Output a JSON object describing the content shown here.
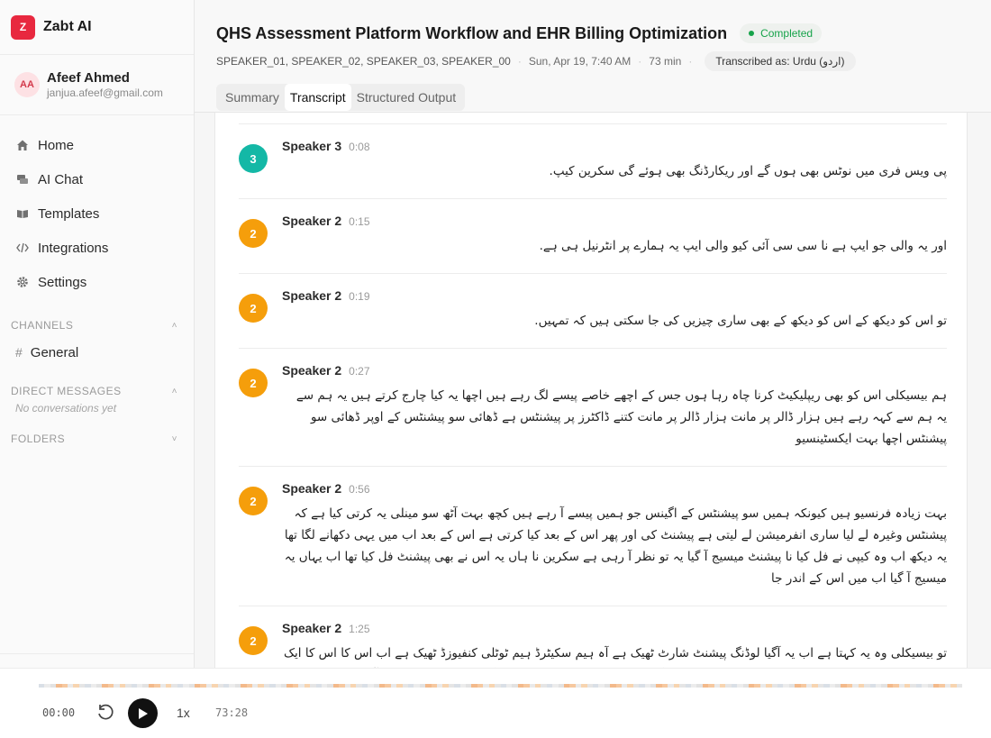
{
  "app": {
    "logo_letter": "Z",
    "name": "Zabt AI"
  },
  "user": {
    "initials": "AA",
    "name": "Afeef Ahmed",
    "email": "janjua.afeef@gmail.com"
  },
  "nav": [
    {
      "label": "Home",
      "icon": "home-icon"
    },
    {
      "label": "AI Chat",
      "icon": "chat-icon"
    },
    {
      "label": "Templates",
      "icon": "book-icon"
    },
    {
      "label": "Integrations",
      "icon": "code-icon"
    },
    {
      "label": "Settings",
      "icon": "gear-icon"
    }
  ],
  "channels": {
    "heading": "CHANNELS",
    "items": [
      {
        "label": "General"
      }
    ]
  },
  "direct_messages": {
    "heading": "DIRECT MESSAGES",
    "empty": "No conversations yet"
  },
  "folders": {
    "heading": "FOLDERS"
  },
  "recording": {
    "title": "QHS Assessment Platform Workflow and EHR Billing Optimization",
    "status": "Completed",
    "speakers": "SPEAKER_01, SPEAKER_02, SPEAKER_03, SPEAKER_00",
    "date": "Sun, Apr 19, 7:40 AM",
    "duration": "73 min",
    "language": "Transcribed as: Urdu (اردو)"
  },
  "tabs": [
    "Summary",
    "Transcript",
    "Structured Output"
  ],
  "colors": {
    "speaker_2": "#f59e0b",
    "speaker_3": "#14b8a6",
    "accent": "#e8283f",
    "status": "#16a34a"
  },
  "transcript": [
    {
      "num": "3",
      "speaker": "Speaker 3",
      "time": "0:08",
      "text": "پی ویس فری میں نوٹس بھی ہوں گے اور ریکارڈنگ بھی ہوئے گی سکرین کیپ."
    },
    {
      "num": "2",
      "speaker": "Speaker 2",
      "time": "0:15",
      "text": "اور یہ والی جو ایپ ہے نا سی سی آئی کیو والی ایپ یہ ہمارے پر انٹرنیل ہی ہے."
    },
    {
      "num": "2",
      "speaker": "Speaker 2",
      "time": "0:19",
      "text": "تو اس کو دیکھ کے اس کو دیکھ کے بھی ساری چیزیں کی جا سکتی ہیں کہ تمہیں."
    },
    {
      "num": "2",
      "speaker": "Speaker 2",
      "time": "0:27",
      "text": "ہم بیسیکلی اس کو بھی ریپلیکیٹ کرنا چاہ رہا ہوں جس کے اچھے خاصے پیسے لگ رہے ہیں اچھا یہ کیا چارج کرتے ہیں یہ ہم سے یہ ہم سے کہہ رہے ہیں ہزار ڈالر پر مانت ہزار ڈالر پر مانت کتنے ڈاکٹرز پر پیشنٹس ہے ڈھائی سو پیشنٹس کے اوپر ڈھائی سو پیشنٹس اچھا بہت ایکسٹینسیو"
    },
    {
      "num": "2",
      "speaker": "Speaker 2",
      "time": "0:56",
      "text": "بہت زیادہ فرنسیو ہیں کیونکہ ہمیں سو پیشنٹس کے اگینس جو ہمیں پیسے آ رہے ہیں کچھ بہت آٹھ سو مینلی یہ کرتی کیا ہے کہ پیشنٹس وغیرہ لے لیا ساری انفرمیشن لے لیتی ہے پیشنٹ کی اور پھر اس کے بعد کیا کرتی ہے اس کے بعد اب میں یہی دکھانے لگا تھا یہ دیکھ اب وہ کیپی نے فل کیا نا پیشنٹ میسیج آ گیا یہ تو نظر آ رہی ہے سکرین نا ہاں یہ اس نے بھی پیشنٹ فل کیا تھا اب یہاں یہ میسیج آ گیا اب میں اس کے اندر جا"
    },
    {
      "num": "2",
      "speaker": "Speaker 2",
      "time": "1:25",
      "text": "تو بیسیکلی وہ یہ کہتا ہے اب یہ آگیا لوڈنگ پیشنٹ شارٹ ٹھیک ہے آہ ہیم سکیٹرڈ ہیم ٹوٹلی کنفیوزڈ ٹھیک ہے اب اس کا اس کا ایک کیئر پلان بنا ہوتا ہے ٹھیک ہے جو ہم نے کیئر پلان بنا ہوا گا ڈاکٹر نے ڈسکس کر کے کہ یار اگر اس کا کوئی مسئلہ آیا ہے پیشنٹ کا اس کو یہ"
    }
  ],
  "player": {
    "current": "00:00",
    "speed": "1x",
    "total": "73:28",
    "progress": 0
  }
}
